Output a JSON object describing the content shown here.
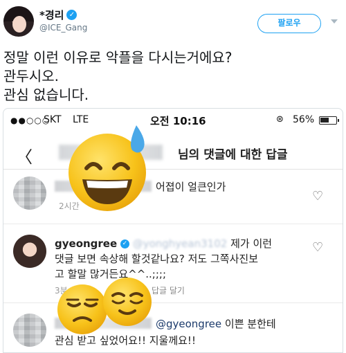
{
  "tweet": {
    "display_name": "*경리",
    "handle": "@ICE_Gang",
    "follow_label": "팔로우",
    "lines": [
      "정말 이런 이유로 악플을 다시는거에요?",
      "관두시오.",
      "관심 없습니다."
    ]
  },
  "screenshot": {
    "status_bar": {
      "signal": "●●○○○",
      "carrier": "SKT",
      "network": "LTE",
      "time": "오전 10:16",
      "lock_icon": "⊛",
      "battery_pct": "56%",
      "battery_level": 0.56
    },
    "nav": {
      "back_glyph": "〈",
      "title": "님의 댓글에 대한 답글"
    },
    "comments": [
      {
        "text": "어졉이 얼큰인가",
        "meta": "2시간"
      },
      {
        "username": "gyeongree",
        "reply_handle": "@yonghyean3102",
        "text_line1": "제가 이런",
        "text_line2": "댓글 보면 속상해 할것같나요? 저도 그쪽사진보",
        "text_line3": "고 할말 많거든요^^..;;;;",
        "meta_prefix": "3분",
        "reply_label": "답글 달기"
      },
      {
        "mention": "@gyeongree",
        "text_line1": "이쁜 분한테",
        "text_line2": "관심 받고 싶었어요!! 지울께요!!"
      }
    ],
    "colors": {
      "twitter_blue": "#1da1f2",
      "emoji_yellow": "#f7c21a",
      "sweat_blue": "#4aa8e8"
    }
  }
}
